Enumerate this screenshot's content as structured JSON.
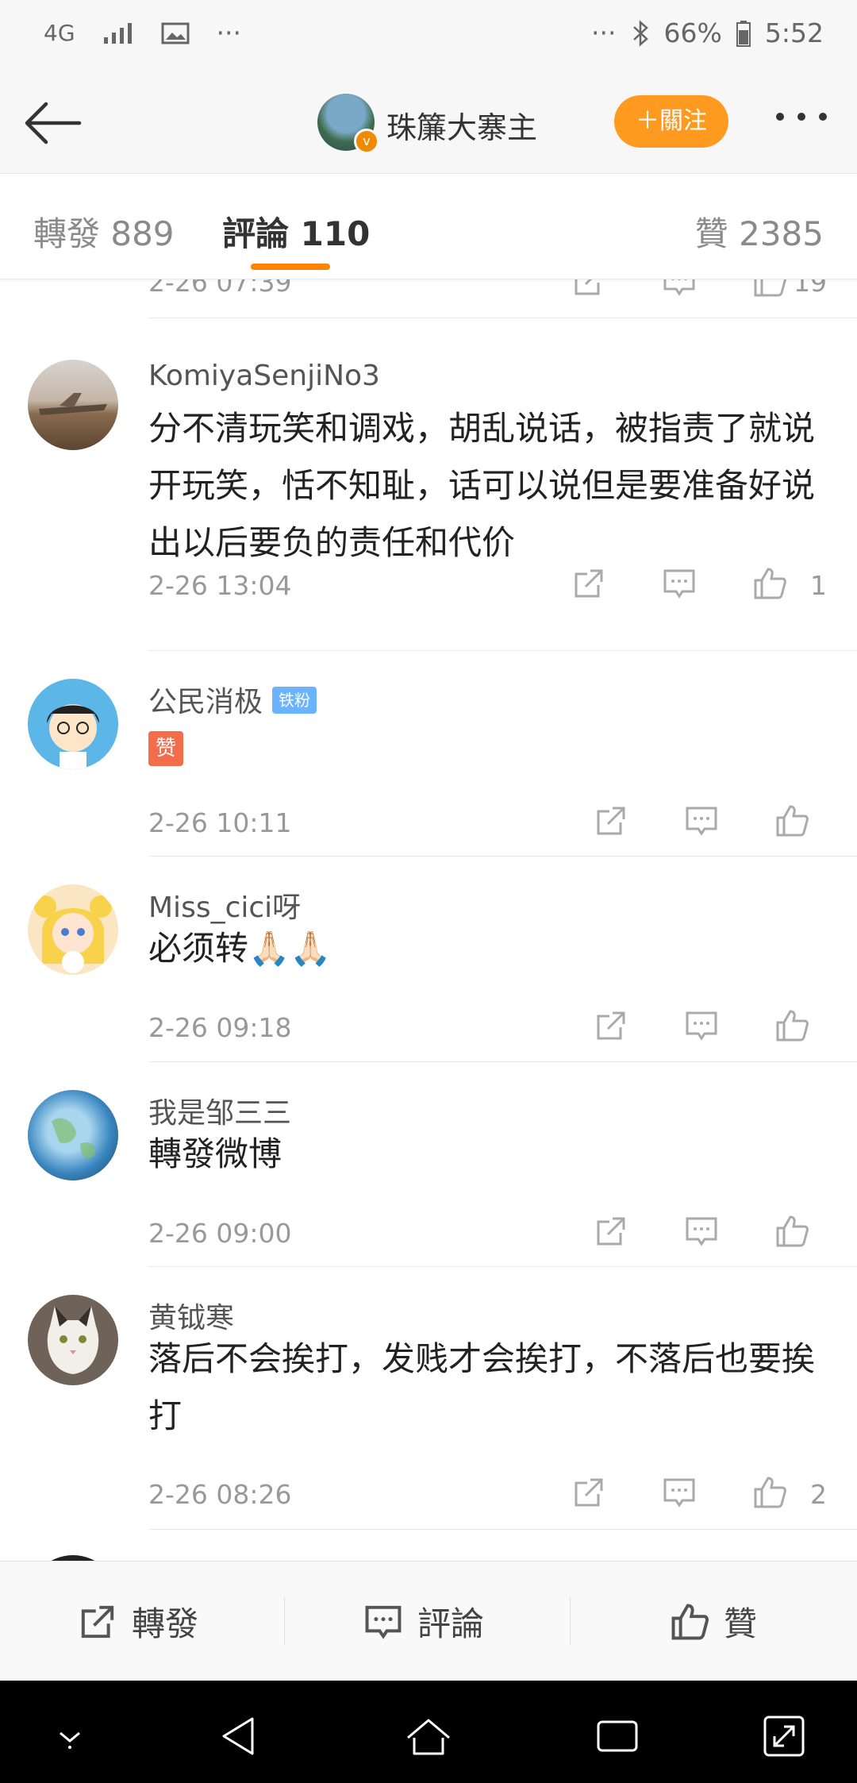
{
  "status_bar": {
    "network": "4G",
    "dots_left": "···",
    "dots_right": "···",
    "battery": "66%",
    "time": "5:52"
  },
  "nav": {
    "title": "珠簾大寨主",
    "follow_label": "＋關注",
    "verified_mark": "v"
  },
  "tabs": [
    {
      "label": "轉發 889"
    },
    {
      "label": "評論 110"
    },
    {
      "label": "贊 2385"
    }
  ],
  "partial_comment": {
    "time": "2-26 07:39",
    "likes": "19"
  },
  "comments": [
    {
      "username": "KomiyaSenjiNo3",
      "content": "分不清玩笑和调戏，胡乱说话，被指责了就说开玩笑，恬不知耻，话可以说但是要准备好说出以后要负的责任和代价",
      "time": "2-26 13:04",
      "likes": "1"
    },
    {
      "username": "公民消极",
      "badge": "铁粉",
      "emoji": "赞",
      "time": "2-26 10:11",
      "likes": ""
    },
    {
      "username": "Miss_cici呀",
      "content": "必须转🙏🏻🙏🏻",
      "time": "2-26 09:18",
      "likes": ""
    },
    {
      "username": "我是邹三三",
      "content": "轉發微博",
      "time": "2-26 09:00",
      "likes": ""
    },
    {
      "username": "黄钺寒",
      "content": "落后不会挨打，发贱才会挨打，不落后也要挨打",
      "time": "2-26 08:26",
      "likes": "2"
    }
  ],
  "bottom_bar": {
    "repost": "轉發",
    "comment": "評論",
    "like": "贊"
  },
  "colors": {
    "accent": "#ff8200",
    "follow": "#ff9a21",
    "badge": "#6bb2ff"
  }
}
